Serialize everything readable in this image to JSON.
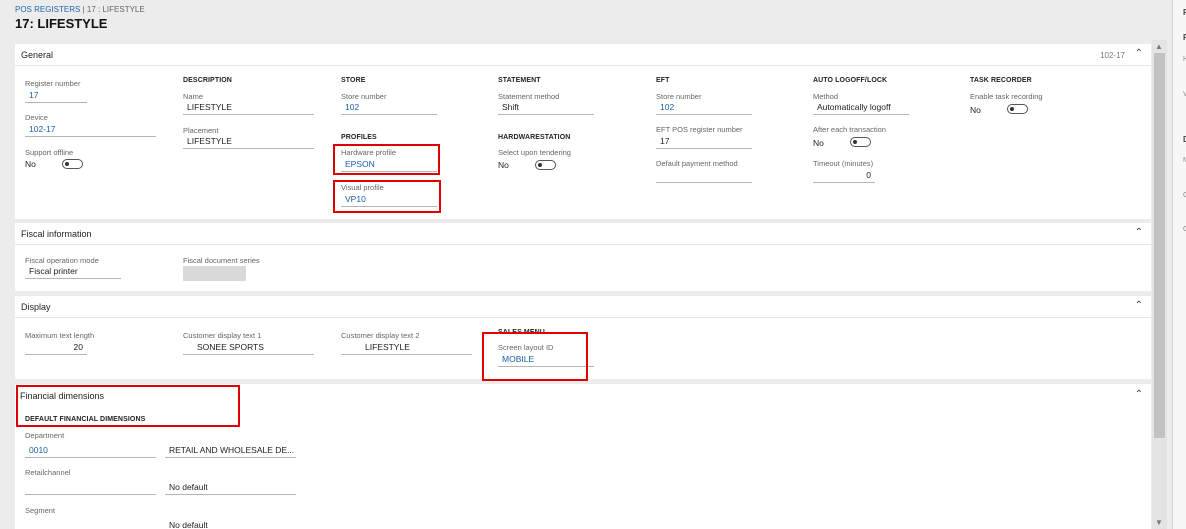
{
  "breadcrumb": {
    "parent": "POS REGISTERS",
    "separator": "|",
    "current": "17 : LIFESTYLE"
  },
  "page_title": "17: LIFESTYLE",
  "icons": {
    "collapse": "chevron-up-icon",
    "scroll_up": "triangle-up-icon",
    "scroll_down": "triangle-down-icon"
  },
  "accent_colors": {
    "link": "#1a5fa8",
    "highlight": "#e00000"
  },
  "general": {
    "title": "General",
    "summary": "102-17",
    "register_number": {
      "label": "Register number",
      "value": "17"
    },
    "device": {
      "label": "Device",
      "value": "102-17"
    },
    "support_offline": {
      "label": "Support offline",
      "value": "No"
    },
    "description": {
      "heading": "DESCRIPTION",
      "name_label": "Name",
      "name_value": "LIFESTYLE",
      "placement_label": "Placement",
      "placement_value": "LIFESTYLE"
    },
    "store": {
      "heading": "STORE",
      "store_number_label": "Store number",
      "store_number_value": "102"
    },
    "profiles": {
      "heading": "PROFILES",
      "hardware_label": "Hardware profile",
      "hardware_value": "EPSON",
      "visual_label": "Visual profile",
      "visual_value": "VP10"
    },
    "statement": {
      "heading": "STATEMENT",
      "method_label": "Statement method",
      "method_value": "Shift"
    },
    "hardwarestation": {
      "heading": "HARDWARESTATION",
      "select_label": "Select upon tendering",
      "select_value": "No"
    },
    "eft": {
      "heading": "EFT",
      "store_number_label": "Store number",
      "store_number_value": "102",
      "pos_register_label": "EFT POS register number",
      "pos_register_value": "17",
      "default_payment_label": "Default payment method",
      "default_payment_value": ""
    },
    "auto_logoff": {
      "heading": "AUTO LOGOFF/LOCK",
      "method_label": "Method",
      "method_value": "Automatically logoff",
      "after_label": "After each transaction",
      "after_value": "No",
      "timeout_label": "Timeout (minutes)",
      "timeout_value": "0"
    },
    "task_recorder": {
      "heading": "TASK RECORDER",
      "enable_label": "Enable task recording",
      "enable_value": "No"
    }
  },
  "fiscal": {
    "title": "Fiscal information",
    "mode_label": "Fiscal operation mode",
    "mode_value": "Fiscal printer",
    "series_label": "Fiscal document series",
    "series_value": ""
  },
  "display": {
    "title": "Display",
    "max_text_label": "Maximum text length",
    "max_text_value": "20",
    "cust_text1_label": "Customer display text 1",
    "cust_text1_value": "SONEE SPORTS",
    "cust_text2_label": "Customer display text 2",
    "cust_text2_value": "LIFESTYLE",
    "sales_menu_heading": "SALES MENU",
    "screen_layout_label": "Screen layout ID",
    "screen_layout_value": "MOBILE"
  },
  "financial": {
    "title": "Financial dimensions",
    "heading": "DEFAULT FINANCIAL DIMENSIONS",
    "department_label": "Department",
    "department_value": "0010",
    "department_desc": "RETAIL AND WHOLESALE DE...",
    "retailchannel_label": "Retailchannel",
    "retailchannel_value": "",
    "retailchannel_desc": "No default",
    "segment_label": "Segment",
    "segment_desc": "No default"
  },
  "right_pane": {
    "letters": [
      "P",
      "H",
      "V",
      "D",
      "M",
      "C",
      "C"
    ]
  }
}
